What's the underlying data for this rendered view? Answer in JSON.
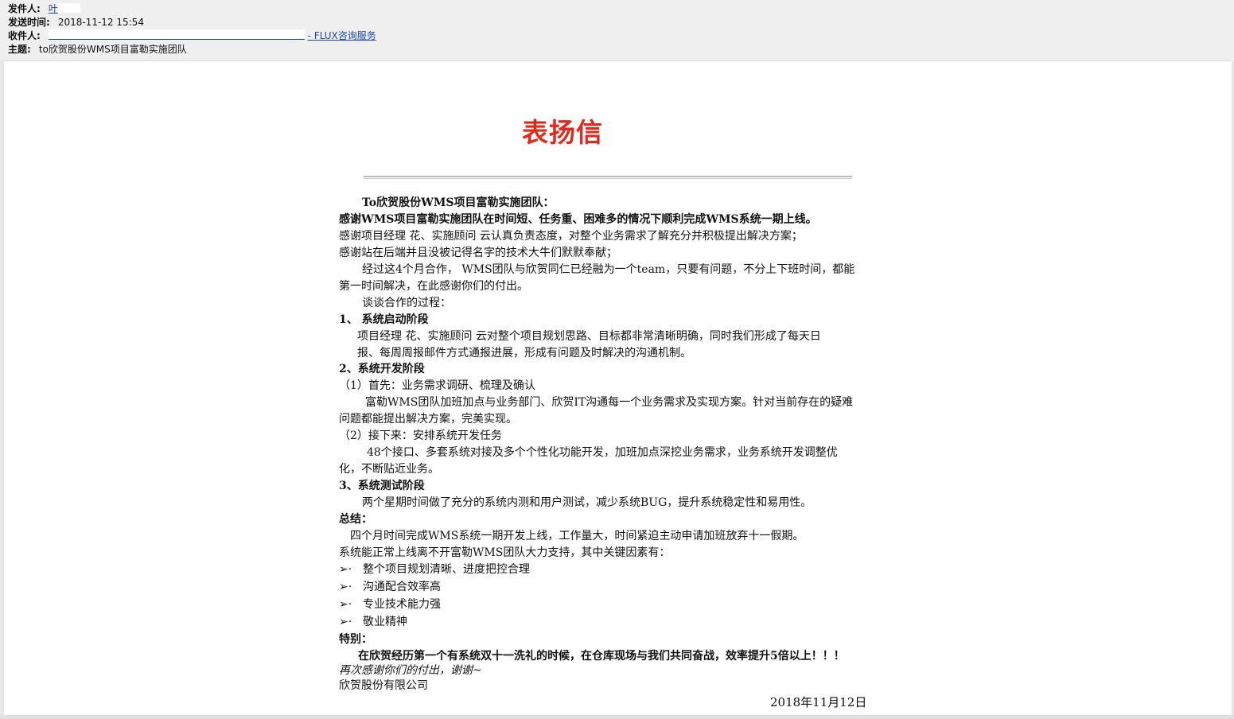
{
  "header": {
    "from_label": "发件人:",
    "from_value": "叶",
    "sent_label": "发送时间:",
    "sent_value": "2018-11-12 15:54",
    "to_label": "收件人:",
    "to_value": "- FLUX咨询服务",
    "subject_label": "主题:",
    "subject_value": "to欣贺股份WMS项目富勒实施团队"
  },
  "letter": {
    "title": "表扬信",
    "lines": [
      "To欣贺股份WMS项目富勒实施团队：",
      "感谢WMS项目富勒实施团队在时间短、任务重、困难多的情况下顺利完成WMS系统一期上线。",
      "感谢项目经理        花、实施顾问      云认真负责态度，对整个业务需求了解充分并积极提出解决方案；",
      "感谢站在后端并且没被记得名字的技术大牛们默默奉献；",
      "经过这4个月合作， WMS团队与欣贺同仁已经融为一个team，只要有问题，不分上下班时间，都能",
      "第一时间解决，在此感谢你们的付出。",
      "谈谈合作的过程：",
      "1、 系统启动阶段",
      "项目经理      花、实施顾问      云对整个项目规划思路、目标都非常清晰明确，同时我们形成了每天日",
      "报、每周周报邮件方式通报进展，形成有问题及时解决的沟通机制。",
      "2、系统开发阶段",
      "（1）首先：业务需求调研、梳理及确认",
      "富勒WMS团队加班加点与业务部门、欣贺IT沟通每一个业务需求及实现方案。针对当前存在的疑难",
      "问题都能提出解决方案，完美实现。",
      "（2）接下来：安排系统开发任务",
      "48个接口、多套系统对接及多个个性化功能开发，加班加点深挖业务需求，业务系统开发调整优",
      "化，不断贴近业务。",
      "3、系统测试阶段",
      "两个星期时间做了充分的系统内测和用户测试，减少系统BUG，提升系统稳定性和易用性。",
      "总结：",
      "四个月时间完成WMS系统一期开发上线，工作量大，时间紧迫主动申请加班放弃十一假期。",
      "系统能正常上线离不开富勒WMS团队大力支持，其中关键因素有：",
      "整个项目规划清晰、进度把控合理",
      "沟通配合效率高",
      "专业技术能力强",
      "敬业精神",
      "特别：",
      "在欣贺经历第一个有系统双十一洗礼的时候，在仓库现场与我们共同奋战，效率提升5倍以上！！！",
      "再次感谢你们的付出，谢谢~",
      "欣贺股份有限公司",
      "2018年11月12日"
    ],
    "bullet_glyph": "➢·"
  }
}
